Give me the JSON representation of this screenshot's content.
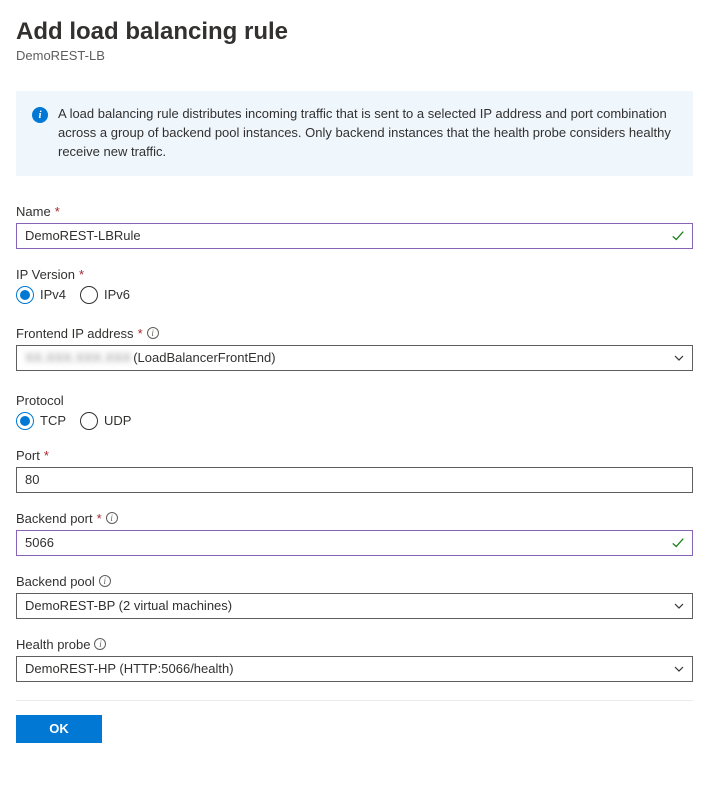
{
  "header": {
    "title": "Add load balancing rule",
    "subtitle": "DemoREST-LB"
  },
  "info_banner": {
    "text": "A load balancing rule distributes incoming traffic that is sent to a selected IP address and port combination across a group of backend pool instances. Only backend instances that the health probe considers healthy receive new traffic."
  },
  "fields": {
    "name": {
      "label": "Name",
      "required_marker": "*",
      "value": "DemoREST-LBRule",
      "validated": true
    },
    "ip_version": {
      "label": "IP Version",
      "required_marker": "*",
      "options": [
        "IPv4",
        "IPv6"
      ],
      "selected": "IPv4"
    },
    "frontend_ip": {
      "label": "Frontend IP address",
      "required_marker": "*",
      "has_help": true,
      "value_prefix_obscured": "XX.XXX.XXX.XXX",
      "value_suffix": " (LoadBalancerFrontEnd)"
    },
    "protocol": {
      "label": "Protocol",
      "options": [
        "TCP",
        "UDP"
      ],
      "selected": "TCP"
    },
    "port": {
      "label": "Port",
      "required_marker": "*",
      "value": "80"
    },
    "backend_port": {
      "label": "Backend port",
      "required_marker": "*",
      "has_help": true,
      "value": "5066",
      "validated": true
    },
    "backend_pool": {
      "label": "Backend pool",
      "has_help": true,
      "value": "DemoREST-BP (2 virtual machines)"
    },
    "health_probe": {
      "label": "Health probe",
      "has_help": true,
      "value": "DemoREST-HP (HTTP:5066/health)"
    }
  },
  "footer": {
    "ok_label": "OK"
  }
}
